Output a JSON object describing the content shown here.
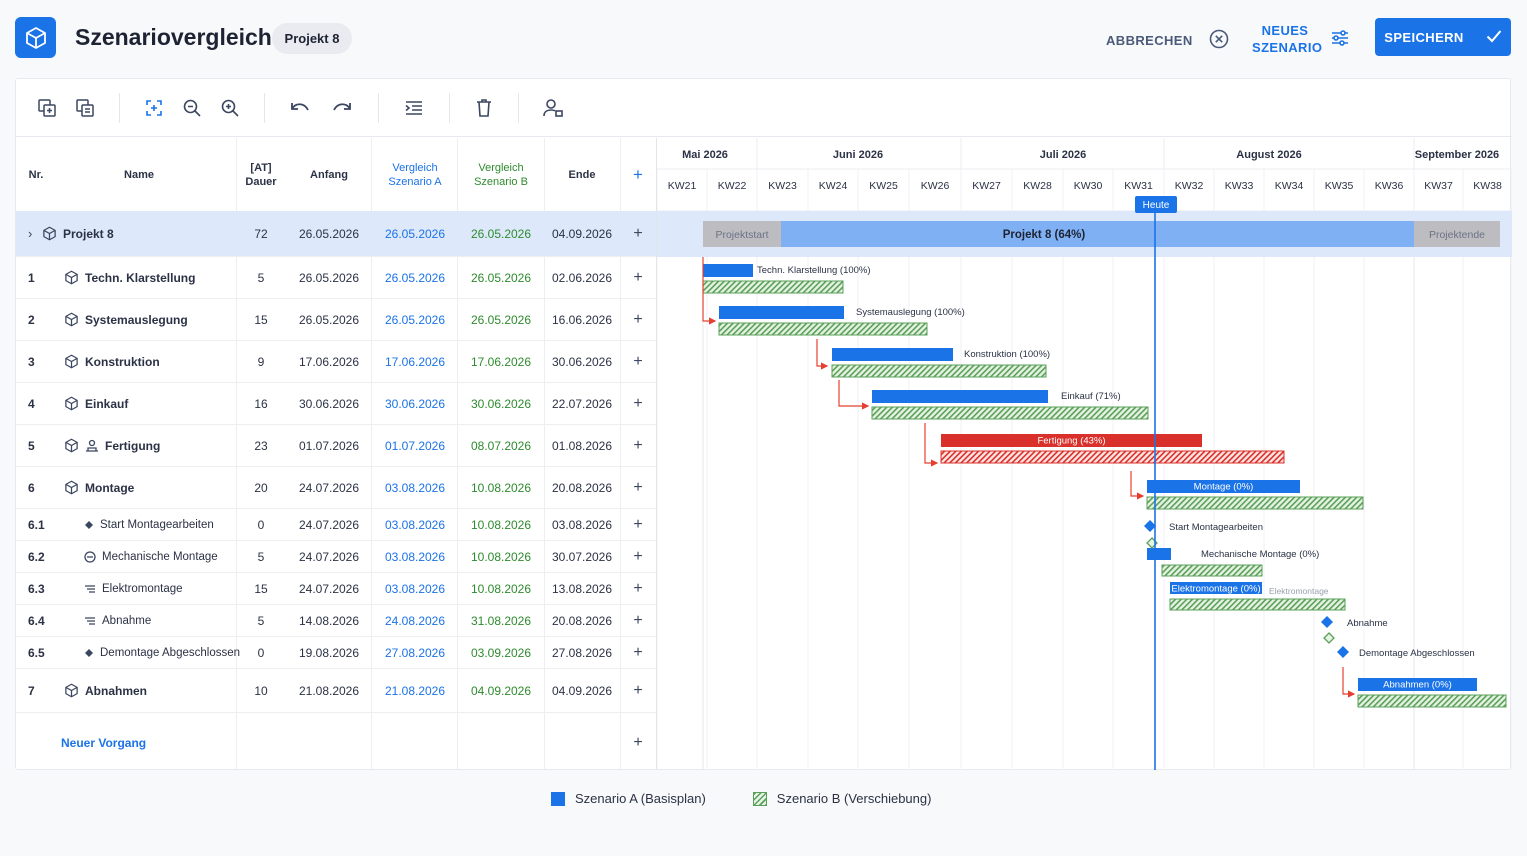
{
  "header": {
    "title": "Szenariovergleich",
    "project_badge": "Projekt 8",
    "cancel_label": "ABBRECHEN",
    "new_scenario_label": "NEUES SZENARIO",
    "save_label": "SPEICHERN",
    "logo_icon": "cube-icon",
    "accent_color": "#1b73e8"
  },
  "toolbar": {
    "icons": [
      "copy-icon",
      "paste-icon",
      "fit-screen-icon",
      "zoom-out-icon",
      "zoom-in-icon",
      "undo-icon",
      "redo-icon",
      "indent-icon",
      "delete-icon",
      "assign-resource-icon"
    ]
  },
  "table": {
    "headers": {
      "nr": "Nr.",
      "name": "Name",
      "duration": "[AT] Dauer",
      "start": "Anfang",
      "compare_a": "Vergleich Szenario A",
      "compare_b": "Vergleich Szenario B",
      "end": "Ende",
      "add": "+"
    },
    "rows": [
      {
        "nr": "›",
        "name": "Projekt 8",
        "duration": "72",
        "start": "26.05.2026",
        "va": "26.05.2026",
        "vb": "26.05.2026",
        "end": "04.09.2026",
        "level": 0
      },
      {
        "nr": "1",
        "name": "Techn. Klarstellung",
        "duration": "5",
        "start": "26.05.2026",
        "va": "26.05.2026",
        "vb": "26.05.2026",
        "end": "02.06.2026",
        "level": 1
      },
      {
        "nr": "2",
        "name": "Systemauslegung",
        "duration": "15",
        "start": "26.05.2026",
        "va": "26.05.2026",
        "vb": "26.05.2026",
        "end": "16.06.2026",
        "level": 1
      },
      {
        "nr": "3",
        "name": "Konstruktion",
        "duration": "9",
        "start": "17.06.2026",
        "va": "17.06.2026",
        "vb": "17.06.2026",
        "end": "30.06.2026",
        "level": 1
      },
      {
        "nr": "4",
        "name": "Einkauf",
        "duration": "16",
        "start": "30.06.2026",
        "va": "30.06.2026",
        "vb": "30.06.2026",
        "end": "22.07.2026",
        "level": 1
      },
      {
        "nr": "5",
        "name": "Fertigung",
        "duration": "23",
        "start": "01.07.2026",
        "va": "01.07.2026",
        "vb": "08.07.2026",
        "end": "01.08.2026",
        "level": 1
      },
      {
        "nr": "6",
        "name": "Montage",
        "duration": "20",
        "start": "24.07.2026",
        "va": "03.08.2026",
        "vb": "10.08.2026",
        "end": "20.08.2026",
        "level": 1
      },
      {
        "nr": "6.1",
        "name": "Start Montagearbeiten",
        "duration": "0",
        "start": "24.07.2026",
        "va": "03.08.2026",
        "vb": "10.08.2026",
        "end": "03.08.2026",
        "level": 2
      },
      {
        "nr": "6.2",
        "name": "Mechanische Montage",
        "duration": "5",
        "start": "24.07.2026",
        "va": "03.08.2026",
        "vb": "10.08.2026",
        "end": "30.07.2026",
        "level": 2
      },
      {
        "nr": "6.3",
        "name": "Elektromontage",
        "duration": "15",
        "start": "24.07.2026",
        "va": "03.08.2026",
        "vb": "10.08.2026",
        "end": "13.08.2026",
        "level": 2
      },
      {
        "nr": "6.4",
        "name": "Abnahme",
        "duration": "5",
        "start": "14.08.2026",
        "va": "24.08.2026",
        "vb": "31.08.2026",
        "end": "20.08.2026",
        "level": 2
      },
      {
        "nr": "6.5",
        "name": "Demontage Abgeschlossen",
        "duration": "0",
        "start": "19.08.2026",
        "va": "27.08.2026",
        "vb": "03.09.2026",
        "end": "27.08.2026",
        "level": 2
      },
      {
        "nr": "7",
        "name": "Abnahmen",
        "duration": "10",
        "start": "21.08.2026",
        "va": "21.08.2026",
        "vb": "04.09.2026",
        "end": "04.09.2026",
        "level": 1
      }
    ],
    "new_task_label": "Neuer Vorgang"
  },
  "gantt": {
    "months": [
      "Mai 2026",
      "Juni 2026",
      "Juli 2026",
      "August 2026",
      "September 2026"
    ],
    "weeks": [
      "KW21",
      "KW22",
      "KW23",
      "KW24",
      "KW25",
      "KW26",
      "KW27",
      "KW28",
      "KW30",
      "KW31",
      "KW32",
      "KW33",
      "KW34",
      "KW35",
      "KW36",
      "KW37",
      "KW38"
    ],
    "today_label": "Heute",
    "project_bar": {
      "label": "Projekt 8 (64%)",
      "start_label": "Projektstart",
      "end_label": "Projektende",
      "progress": 0.64
    },
    "bar_labels": {
      "r1": "Techn. Klarstellung (100%)",
      "r2": "Systemauslegung (100%)",
      "r3": "Konstruktion (100%)",
      "r4": "Einkauf (71%)",
      "r5": "Fertigung (43%)",
      "r6": "Montage (0%)",
      "r61": "Start Montagearbeiten",
      "r62": "Mechanische Montage (0%)",
      "r63": "Elektromontage (0%)",
      "r63b": "Elektromontage",
      "r64": "Abnahme",
      "r65": "Demontage Abgeschlossen",
      "r7": "Abnahmen (0%)"
    },
    "progress": {
      "r1": 1.0,
      "r2": 1.0,
      "r3": 1.0,
      "r4": 0.71,
      "r5": 0.43,
      "r6": 0,
      "r62": 0,
      "r63": 0,
      "r7": 0
    },
    "colors": {
      "scenario_a": "#1b73e8",
      "scenario_b": "#5aa05a",
      "critical": "#d9302b",
      "dependency": "#e5402f",
      "today": "#1b73e8"
    }
  },
  "legend": {
    "scenario_a": "Szenario A (Basisplan)",
    "scenario_b": "Szenario B (Verschiebung)"
  }
}
